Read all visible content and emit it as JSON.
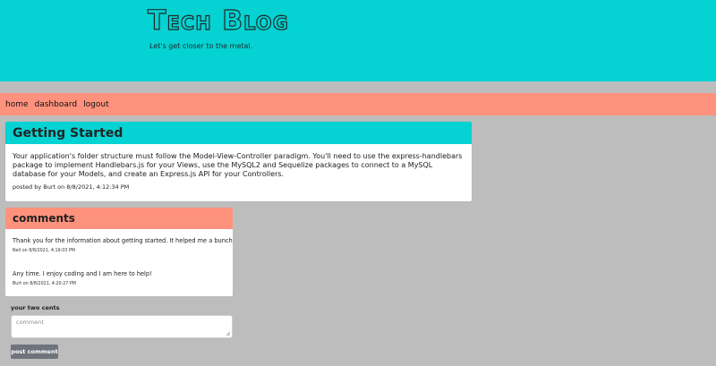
{
  "header": {
    "title": "Tech Blog",
    "tagline": "Let's get closer to the metal."
  },
  "nav": {
    "items": [
      {
        "label": "home"
      },
      {
        "label": "dashboard"
      },
      {
        "label": "logout"
      }
    ]
  },
  "post": {
    "title": "Getting Started",
    "body": "Your application's folder structure must follow the Model-View-Controller paradigm. You'll need to use the express-handlebars package to implement Handlebars.js for your Views, use the MySQL2 and Sequelize packages to connect to a MySQL database for your Models, and create an Express.js API for your Controllers.",
    "meta": "posted by Burt on 8/8/2021, 4:12:34 PM"
  },
  "comments": {
    "title": "comments",
    "items": [
      {
        "text": "Thank you for the information about getting started. It helped me a bunch!",
        "meta": "Neil on 8/8/2021, 4:19:03 PM"
      },
      {
        "text": "Any time. I enjoy coding and I am here to help!",
        "meta": "Burt on 8/8/2021, 4:20:27 PM"
      }
    ]
  },
  "form": {
    "label": "your two cents",
    "placeholder": "comment",
    "submit_label": "post comment"
  },
  "colors": {
    "background": "#bdbdbd",
    "hero": "#05d2d2",
    "nav": "#ff927d",
    "card": "#ffffff",
    "button": "#6e737c"
  }
}
